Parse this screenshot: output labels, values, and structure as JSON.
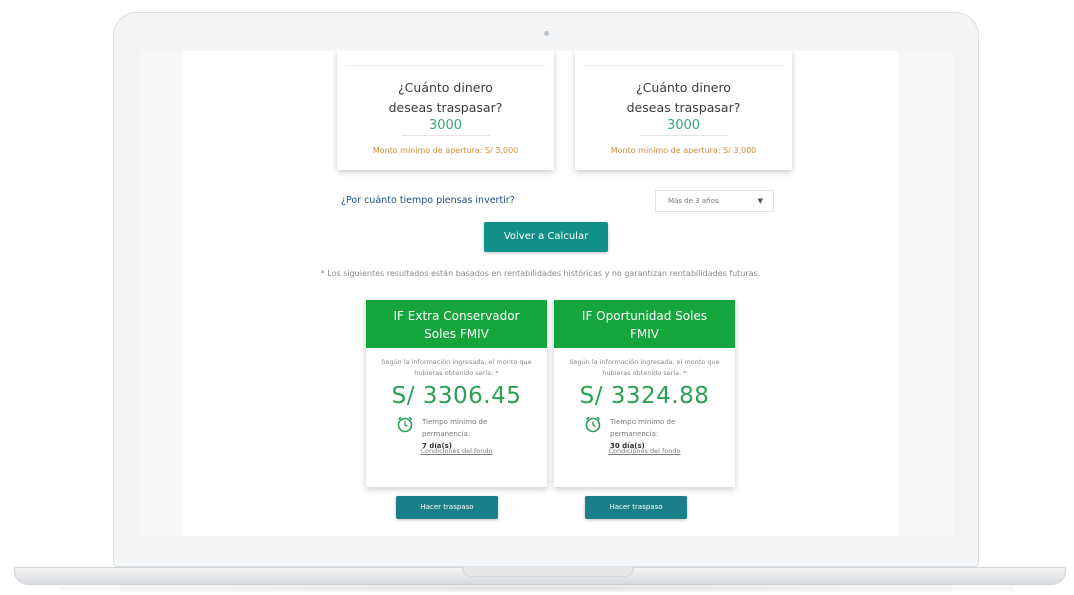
{
  "amount_cards": [
    {
      "question": "¿Cuánto dinero deseas traspasar?",
      "value": "3000",
      "min_note": "Monto mínimo de apertura: S/ 3,000"
    },
    {
      "question": "¿Cuánto dinero deseas traspasar?",
      "value": "3000",
      "min_note": "Monto mínimo de apertura: S/ 3,000"
    }
  ],
  "period": {
    "question": "¿Por cuánto tiempo piensas invertir?",
    "selected": "Más de 3 años"
  },
  "recalc_label": "Volver a Calcular",
  "disclaimer": "* Los siguientes resultados están basados en rentabilidades históricas y no garantizan rentabilidades futuras.",
  "funds": [
    {
      "title": "IF Extra Conservador Soles FMIV",
      "description": "Según la información ingresada, el monto que hubieras obtenido sería: *",
      "value": "S/ 3306.45",
      "tenure_label": "Tiempo mínimo de permanencia:",
      "tenure_value": "7 día(s)",
      "conditions_link": "Condiciones del fondo",
      "button": "Hacer traspaso"
    },
    {
      "title": "IF Oportunidad Soles FMIV",
      "description": "Según la información ingresada, el monto que hubieras obtenido sería: *",
      "value": "S/ 3324.88",
      "tenure_label": "Tiempo mínimo de permanencia:",
      "tenure_value": "30 día(s)",
      "conditions_link": "Condiciones del fondo",
      "button": "Hacer traspaso"
    }
  ],
  "colors": {
    "fund_header": "#14a53c",
    "value_green": "#2aa052",
    "button_teal": "#138f8a",
    "min_note": "#d08a3a",
    "question_blue": "#1f4e8c"
  },
  "icons": [
    "clock-icon",
    "chevron-down-icon"
  ]
}
